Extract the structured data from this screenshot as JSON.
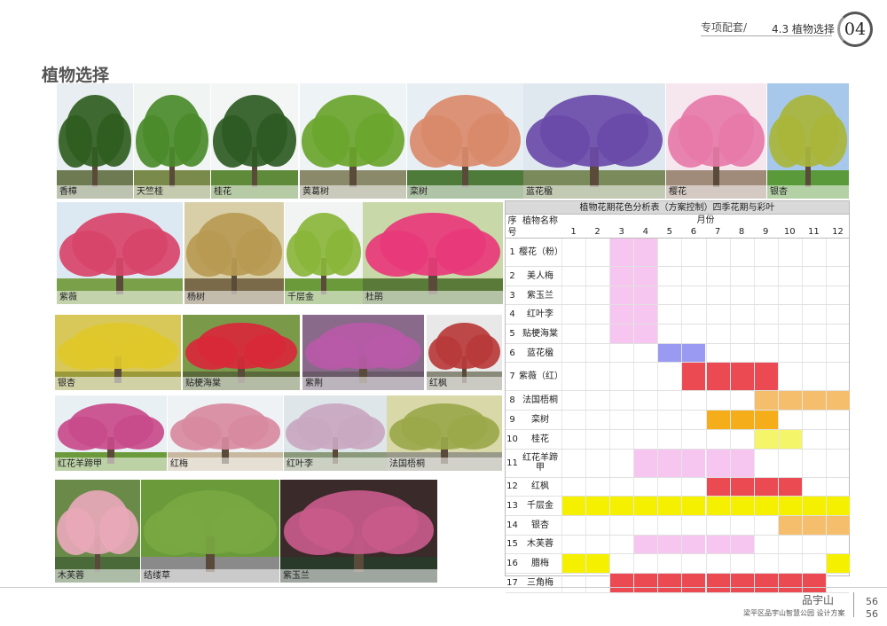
{
  "header": {
    "section": "专项配套/",
    "subsection": "4.3 植物选择",
    "chapter": "04"
  },
  "title": "植物选择",
  "photos": [
    {
      "caption": "香樟",
      "sky": "#e8eef2",
      "crown": "#2f5d1f",
      "ground": "#6d7a52"
    },
    {
      "caption": "天竺桂",
      "sky": "#f0f4f2",
      "crown": "#4a8a2a",
      "ground": "#7a8a4a"
    },
    {
      "caption": "桂花",
      "sky": "#f4f6f6",
      "crown": "#2d5a22",
      "ground": "#5f8a3a"
    },
    {
      "caption": "黄葛树",
      "sky": "#eef3f6",
      "crown": "#6aa52c",
      "ground": "#8a8a6a"
    },
    {
      "caption": "栾树",
      "sky": "#e8eff4",
      "crown": "#d98a6a",
      "ground": "#4e7a3a"
    },
    {
      "caption": "蓝花楹",
      "sky": "#dfe8ef",
      "crown": "#6a4aa8",
      "ground": "#7a8a5a"
    },
    {
      "caption": "樱花",
      "sky": "#f6e6ee",
      "crown": "#e67aa8",
      "ground": "#a08a7a"
    },
    {
      "caption": "银杏",
      "sky": "#a7c8ea",
      "crown": "#a9b53a",
      "ground": "#5a9a3a"
    },
    {
      "caption": "紫薇",
      "sky": "#dde9f2",
      "crown": "#d8446a",
      "ground": "#7aa04a"
    },
    {
      "caption": "杨树",
      "sky": "#d8cfa8",
      "crown": "#b89a52",
      "ground": "#7a6a4a"
    },
    {
      "caption": "千层金",
      "sky": "#f2f4f4",
      "crown": "#8ab53a",
      "ground": "#6a9a3a"
    },
    {
      "caption": "杜鹃",
      "sky": "#c8d8a8",
      "crown": "#e83a7a",
      "ground": "#5a7a3a"
    },
    {
      "caption": "银杏",
      "sky": "#d8c85a",
      "crown": "#e0c82a",
      "ground": "#9a9a3a"
    },
    {
      "caption": "贴梗海棠",
      "sky": "#7a9a4a",
      "crown": "#d8283a",
      "ground": "#5a6a3a"
    },
    {
      "caption": "紫荆",
      "sky": "#8a6a8a",
      "crown": "#b85aa8",
      "ground": "#6a5a6a"
    },
    {
      "caption": "红枫",
      "sky": "#e8e8e8",
      "crown": "#b83a3a",
      "ground": "#8a8a7a"
    },
    {
      "caption": "红花羊蹄甲",
      "sky": "#e8f0f4",
      "crown": "#c84a8a",
      "ground": "#6a9a3a"
    },
    {
      "caption": "红梅",
      "sky": "#eef2f4",
      "crown": "#d88aa0",
      "ground": "#c8b8a0"
    },
    {
      "caption": "红叶李",
      "sky": "#dfe6ea",
      "crown": "#c8a8c0",
      "ground": "#8a9a7a"
    },
    {
      "caption": "法国梧桐",
      "sky": "#d8d8a8",
      "crown": "#9aa84a",
      "ground": "#9a9a8a"
    },
    {
      "caption": "木芙蓉",
      "sky": "#6a8a4a",
      "crown": "#e8a8b8",
      "ground": "#4a6a3a"
    },
    {
      "caption": "结缕草",
      "sky": "#6a9a3a",
      "crown": "#7aa842",
      "ground": "#8a8a8a"
    },
    {
      "caption": "紫玉兰",
      "sky": "#3a2a2a",
      "crown": "#c85a8a",
      "ground": "#2a3a2a"
    }
  ],
  "table": {
    "title": "植物花期花色分析表（方案控制）四季花期与彩叶",
    "idx_header": "序号",
    "name_header": "植物名称",
    "month_header": "月份",
    "months": [
      "1",
      "2",
      "3",
      "4",
      "5",
      "6",
      "7",
      "8",
      "9",
      "10",
      "11",
      "12"
    ],
    "rows": [
      {
        "idx": "1",
        "name": "樱花（粉）",
        "color": "#f7c6f0",
        "months": [
          3,
          4
        ]
      },
      {
        "idx": "2",
        "name": "美人梅",
        "color": "#f7c6f0",
        "months": [
          3,
          4
        ]
      },
      {
        "idx": "3",
        "name": "紫玉兰",
        "color": "#f7c6f0",
        "months": [
          3,
          4
        ]
      },
      {
        "idx": "4",
        "name": "红叶李",
        "color": "#f7c6f0",
        "months": [
          3,
          4
        ]
      },
      {
        "idx": "5",
        "name": "贴梗海棠",
        "color": "#f7c6f0",
        "months": [
          3,
          4
        ]
      },
      {
        "idx": "6",
        "name": "蓝花楹",
        "color": "#9a9af2",
        "months": [
          5,
          6
        ]
      },
      {
        "idx": "7",
        "name": "紫薇（红）",
        "color": "#ec4a52",
        "months": [
          6,
          7,
          8,
          9
        ]
      },
      {
        "idx": "8",
        "name": "法国梧桐",
        "color": "#f5be6c",
        "months": [
          9,
          10,
          11,
          12
        ]
      },
      {
        "idx": "9",
        "name": "栾树",
        "color": "#f5ad1a",
        "months": [
          7,
          8,
          9
        ]
      },
      {
        "idx": "10",
        "name": "桂花",
        "color": "#f5f56a",
        "months": [
          9,
          10
        ]
      },
      {
        "idx": "11",
        "name": "红花羊蹄甲",
        "color": "#f7c6f0",
        "months": [
          4,
          5,
          6,
          7,
          8
        ]
      },
      {
        "idx": "12",
        "name": "红枫",
        "color": "#ec4a52",
        "months": [
          7,
          8,
          9,
          10
        ]
      },
      {
        "idx": "13",
        "name": "千层金",
        "color": "#f5f000",
        "months": [
          1,
          2,
          3,
          4,
          5,
          6,
          7,
          8,
          9,
          10,
          11,
          12
        ]
      },
      {
        "idx": "14",
        "name": "银杏",
        "color": "#f5be6c",
        "months": [
          10,
          11,
          12
        ]
      },
      {
        "idx": "15",
        "name": "木芙蓉",
        "color": "#f7c6f0",
        "months": [
          4,
          5,
          6,
          7,
          8
        ]
      },
      {
        "idx": "16",
        "name": "腊梅",
        "color": "#f5f000",
        "months": [
          1,
          2,
          12
        ]
      },
      {
        "idx": "17",
        "name": "三角梅",
        "color": "#ec4a52",
        "months": [
          3,
          4,
          5,
          6,
          7,
          8,
          9,
          10,
          11
        ]
      }
    ]
  },
  "footer": {
    "brand": "品宇山",
    "subtitle": "梁平区品宇山智慧公园 设计方案",
    "page_top": "56",
    "page_bottom": "56"
  }
}
